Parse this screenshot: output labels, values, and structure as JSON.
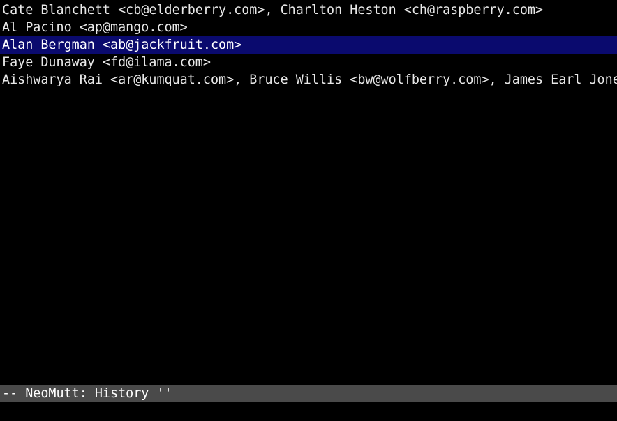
{
  "history": {
    "selected_index": 2,
    "entries": [
      "Cate Blanchett <cb@elderberry.com>, Charlton Heston <ch@raspberry.com>",
      "Al Pacino <ap@mango.com>",
      "Alan Bergman <ab@jackfruit.com>",
      "Faye Dunaway <fd@ilama.com>",
      "Aishwarya Rai <ar@kumquat.com>, Bruce Willis <bw@wolfberry.com>, James Earl Jone"
    ]
  },
  "status_bar": {
    "text": "-- NeoMutt: History ''"
  },
  "colors": {
    "background": "#000000",
    "foreground": "#e8e8e8",
    "selection": "#0a0a6e",
    "status_bar": "#4a4a4a"
  }
}
